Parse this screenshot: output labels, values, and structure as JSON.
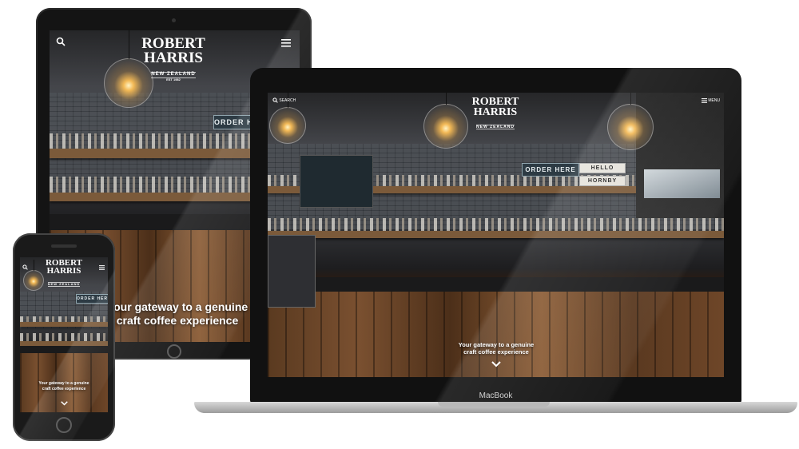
{
  "site": {
    "logo": {
      "line1": "ROBERT",
      "line2": "HARRIS",
      "sub": "NEW ZEALAND",
      "est": "EST 1982"
    },
    "search_label": "SEARCH",
    "menu_label": "MENU",
    "tagline": "Your gateway to a genuine craft coffee experience",
    "tagline_line1": "Your gateway to a genuine",
    "tagline_line2": "craft coffee experience",
    "phone_tagline_line1": "Your gateway to a genuine",
    "phone_tagline_line2": "craft coffee experience",
    "signs": {
      "order": "ORDER HERE",
      "hello": "HELLO",
      "hornby": "HORNBY"
    }
  },
  "devices": {
    "laptop_brand": "MacBook"
  },
  "icons": {
    "search": "search-icon",
    "menu": "menu-icon",
    "scroll": "chevron-down-icon"
  }
}
